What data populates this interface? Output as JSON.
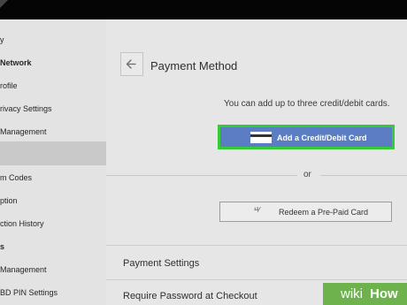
{
  "window": {
    "topbar_icon": "corner-icon"
  },
  "sidebar": {
    "items": [
      {
        "label": "y",
        "kind": "item"
      },
      {
        "label": "Network",
        "kind": "header"
      },
      {
        "label": "rofile",
        "kind": "item"
      },
      {
        "label": "rivacy Settings",
        "kind": "item"
      },
      {
        "label": "Management",
        "kind": "item"
      },
      {
        "label": "",
        "kind": "active"
      },
      {
        "label": "m Codes",
        "kind": "item"
      },
      {
        "label": "ption",
        "kind": "item"
      },
      {
        "label": "ction History",
        "kind": "item"
      },
      {
        "label": "s",
        "kind": "header"
      },
      {
        "label": "Management",
        "kind": "item"
      },
      {
        "label": "BD PIN Settings",
        "kind": "item"
      }
    ]
  },
  "main": {
    "back_icon": "arrow-left-icon",
    "title": "Payment Method",
    "info_text": "You can add up to three credit/debit cards.",
    "add_card": {
      "label": "Add a Credit/Debit Card",
      "icon": "credit-card-icon"
    },
    "or_text": "or",
    "redeem": {
      "label": "Redeem a Pre-Paid Card",
      "icon_text": "¹²⁄"
    },
    "payment_settings_title": "Payment Settings",
    "require_password_label": "Require Password at Checkout"
  },
  "watermark": {
    "part1": "wiki",
    "part2": "How"
  },
  "colors": {
    "accent_blue": "#5a7dc3",
    "highlight_green": "#36c93a",
    "watermark_green": "#5cab37"
  }
}
